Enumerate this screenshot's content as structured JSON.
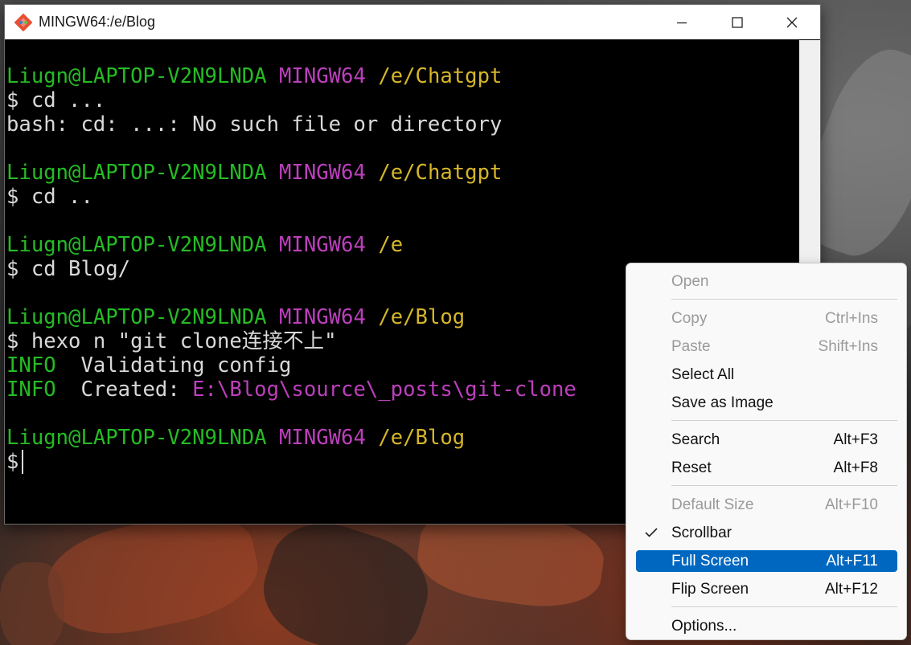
{
  "window": {
    "title": "MINGW64:/e/Blog"
  },
  "terminal": {
    "lines": [
      [
        {
          "t": "Liugn@LAPTOP-V2N9LNDA",
          "c": "green"
        },
        {
          "t": " ",
          "c": "white"
        },
        {
          "t": "MINGW64",
          "c": "purple"
        },
        {
          "t": " ",
          "c": "white"
        },
        {
          "t": "/e/Chatgpt",
          "c": "yellow"
        }
      ],
      [
        {
          "t": "$ cd ...",
          "c": "white"
        }
      ],
      [
        {
          "t": "bash: cd: ...: No such file or directory",
          "c": "white"
        }
      ],
      [],
      [
        {
          "t": "Liugn@LAPTOP-V2N9LNDA",
          "c": "green"
        },
        {
          "t": " ",
          "c": "white"
        },
        {
          "t": "MINGW64",
          "c": "purple"
        },
        {
          "t": " ",
          "c": "white"
        },
        {
          "t": "/e/Chatgpt",
          "c": "yellow"
        }
      ],
      [
        {
          "t": "$ cd ..",
          "c": "white"
        }
      ],
      [],
      [
        {
          "t": "Liugn@LAPTOP-V2N9LNDA",
          "c": "green"
        },
        {
          "t": " ",
          "c": "white"
        },
        {
          "t": "MINGW64",
          "c": "purple"
        },
        {
          "t": " ",
          "c": "white"
        },
        {
          "t": "/e",
          "c": "yellow"
        }
      ],
      [
        {
          "t": "$ cd Blog/",
          "c": "white"
        }
      ],
      [],
      [
        {
          "t": "Liugn@LAPTOP-V2N9LNDA",
          "c": "green"
        },
        {
          "t": " ",
          "c": "white"
        },
        {
          "t": "MINGW64",
          "c": "purple"
        },
        {
          "t": " ",
          "c": "white"
        },
        {
          "t": "/e/Blog",
          "c": "yellow"
        }
      ],
      [
        {
          "t": "$ hexo n \"git clone连接不上\"",
          "c": "white"
        }
      ],
      [
        {
          "t": "INFO",
          "c": "green"
        },
        {
          "t": "  Validating config",
          "c": "white"
        }
      ],
      [
        {
          "t": "INFO",
          "c": "green"
        },
        {
          "t": "  Created: ",
          "c": "white"
        },
        {
          "t": "E:\\Blog\\source\\_posts\\git-clone",
          "c": "purple"
        }
      ],
      [],
      [
        {
          "t": "Liugn@LAPTOP-V2N9LNDA",
          "c": "green"
        },
        {
          "t": " ",
          "c": "white"
        },
        {
          "t": "MINGW64",
          "c": "purple"
        },
        {
          "t": " ",
          "c": "white"
        },
        {
          "t": "/e/Blog",
          "c": "yellow"
        }
      ],
      [
        {
          "t": "$",
          "c": "white"
        }
      ]
    ],
    "colors": {
      "green": "#25bc24",
      "purple": "#bc3fbc",
      "yellow": "#d6b62a",
      "text": "#d9d9d9",
      "background": "#000000"
    }
  },
  "context_menu": {
    "items": {
      "open": {
        "label": "Open",
        "shortcut": ""
      },
      "copy": {
        "label": "Copy",
        "shortcut": "Ctrl+Ins"
      },
      "paste": {
        "label": "Paste",
        "shortcut": "Shift+Ins"
      },
      "select_all": {
        "label": "Select All",
        "shortcut": ""
      },
      "save_as_image": {
        "label": "Save as Image",
        "shortcut": ""
      },
      "search": {
        "label": "Search",
        "shortcut": "Alt+F3"
      },
      "reset": {
        "label": "Reset",
        "shortcut": "Alt+F8"
      },
      "default_size": {
        "label": "Default Size",
        "shortcut": "Alt+F10"
      },
      "scrollbar": {
        "label": "Scrollbar",
        "shortcut": "",
        "checked": true
      },
      "full_screen": {
        "label": "Full Screen",
        "shortcut": "Alt+F11"
      },
      "flip_screen": {
        "label": "Flip Screen",
        "shortcut": "Alt+F12"
      },
      "options": {
        "label": "Options...",
        "shortcut": ""
      }
    },
    "highlight_color": "#0067c0"
  }
}
